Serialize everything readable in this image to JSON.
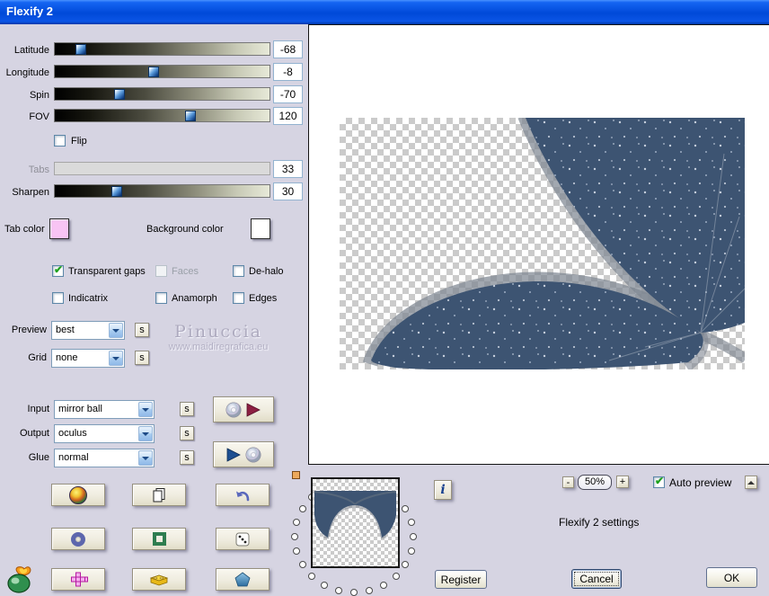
{
  "window": {
    "title": "Flexify 2"
  },
  "sliders": [
    {
      "label": "Latitude",
      "value": "-68",
      "pos": "12%",
      "disabled": false
    },
    {
      "label": "Longitude",
      "value": "-8",
      "pos": "46%",
      "disabled": false
    },
    {
      "label": "Spin",
      "value": "-70",
      "pos": "30%",
      "disabled": false
    },
    {
      "label": "FOV",
      "value": "120",
      "pos": "63%",
      "disabled": false
    },
    {
      "label": "Tabs",
      "value": "33",
      "pos": "0%",
      "disabled": true
    },
    {
      "label": "Sharpen",
      "value": "30",
      "pos": "29%",
      "disabled": false
    }
  ],
  "flip": {
    "label": "Flip",
    "checked": false
  },
  "color_pickers": {
    "tab": {
      "label": "Tab color",
      "color": "#f8c4f4"
    },
    "background": {
      "label": "Background color",
      "color": "#ffffff"
    }
  },
  "checkboxes": [
    {
      "label": "Transparent gaps",
      "checked": true,
      "disabled": false
    },
    {
      "label": "Faces",
      "checked": false,
      "disabled": true
    },
    {
      "label": "De-halo",
      "checked": false,
      "disabled": false
    },
    {
      "label": "Indicatrix",
      "checked": false,
      "disabled": false
    },
    {
      "label": "Anamorph",
      "checked": false,
      "disabled": false
    },
    {
      "label": "Edges",
      "checked": false,
      "disabled": false
    }
  ],
  "dropdowns": [
    {
      "label": "Preview",
      "value": "best"
    },
    {
      "label": "Grid",
      "value": "none"
    },
    {
      "label": "Input",
      "value": "mirror ball"
    },
    {
      "label": "Output",
      "value": "oculus"
    },
    {
      "label": "Glue",
      "value": "normal"
    }
  ],
  "s_button": "s",
  "watermark": {
    "line1": "Pinuccia",
    "line2": "www.maidiregrafica.eu"
  },
  "zoom_controls": {
    "minus": "-",
    "value": "50%",
    "plus": "+"
  },
  "auto_preview": {
    "label": "Auto preview",
    "checked": true
  },
  "status_text": "Flexify 2 settings",
  "action_buttons": {
    "register": "Register",
    "cancel": "Cancel",
    "ok": "OK"
  },
  "info_button": "i",
  "theme": {
    "panel": "#d6d4e2",
    "titlebar": "#0049d8",
    "blue_shape": "#3d5472",
    "gray_band": "#7e8691"
  }
}
